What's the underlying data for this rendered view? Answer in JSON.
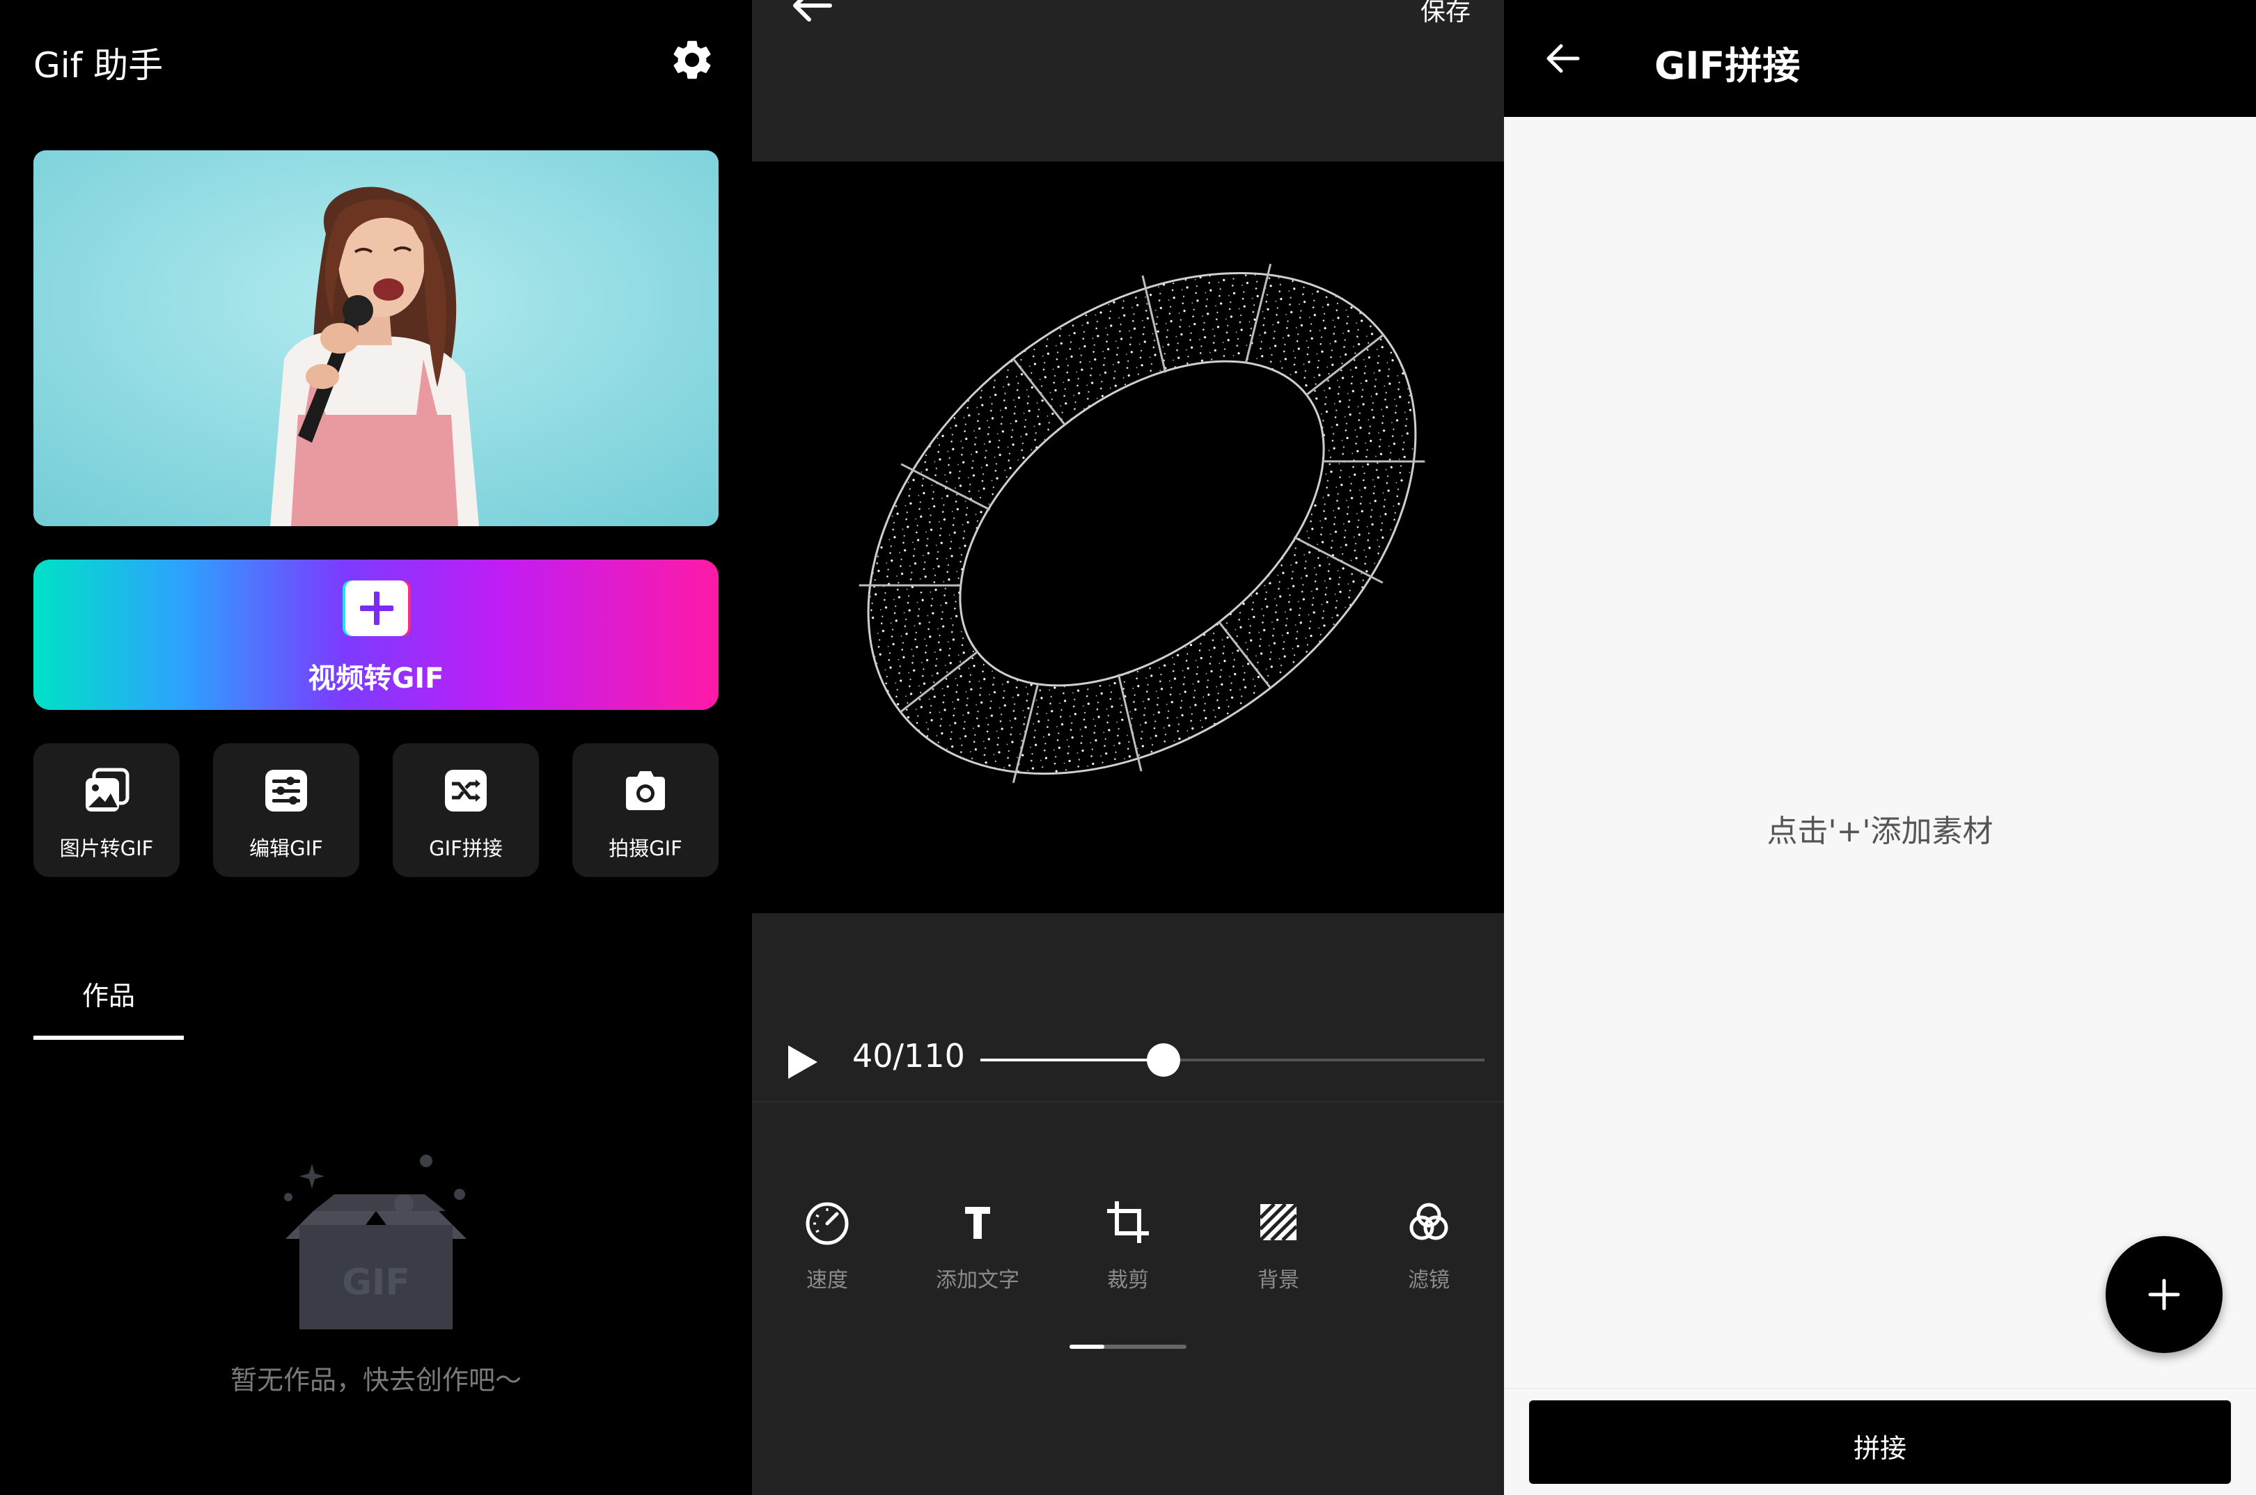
{
  "home": {
    "app_title": "Gif 助手",
    "icons": {
      "settings": "gear-icon"
    },
    "banner": {
      "image": "woman-singing-into-microphone-photo"
    },
    "cta": {
      "label": "视频转GIF",
      "icon": "plus-icon"
    },
    "tools": [
      {
        "label": "图片转GIF",
        "icon": "image-stack-icon"
      },
      {
        "label": "编辑GIF",
        "icon": "sliders-icon"
      },
      {
        "label": "GIF拼接",
        "icon": "shuffle-icon"
      },
      {
        "label": "拍摄GIF",
        "icon": "camera-icon"
      }
    ],
    "tab": {
      "label": "作品"
    },
    "empty": {
      "text": "暂无作品，快去创作吧～",
      "box_text": "GIF"
    }
  },
  "editor": {
    "save_label": "保存",
    "player": {
      "frame_text": "40/110",
      "current_frame": 40,
      "total_frames": 110
    },
    "tools": [
      {
        "label": "速度",
        "icon": "speedometer-icon"
      },
      {
        "label": "添加文字",
        "icon": "text-icon"
      },
      {
        "label": "裁剪",
        "icon": "crop-icon"
      },
      {
        "label": "背景",
        "icon": "background-pattern-icon"
      },
      {
        "label": "滤镜",
        "icon": "filter-circles-icon"
      }
    ]
  },
  "stitch": {
    "title": "GIF拼接",
    "hint": "点击'+'添加素材",
    "fab_icon": "plus-icon",
    "button_label": "拼接"
  },
  "colors": {
    "cta_gradient": [
      "#00e2c6",
      "#2ea0ff",
      "#7b3cff",
      "#c01df5",
      "#ff1aa6"
    ],
    "dark_bg": "#000000",
    "editor_bg": "#222222",
    "light_bg": "#f7f7f7"
  }
}
